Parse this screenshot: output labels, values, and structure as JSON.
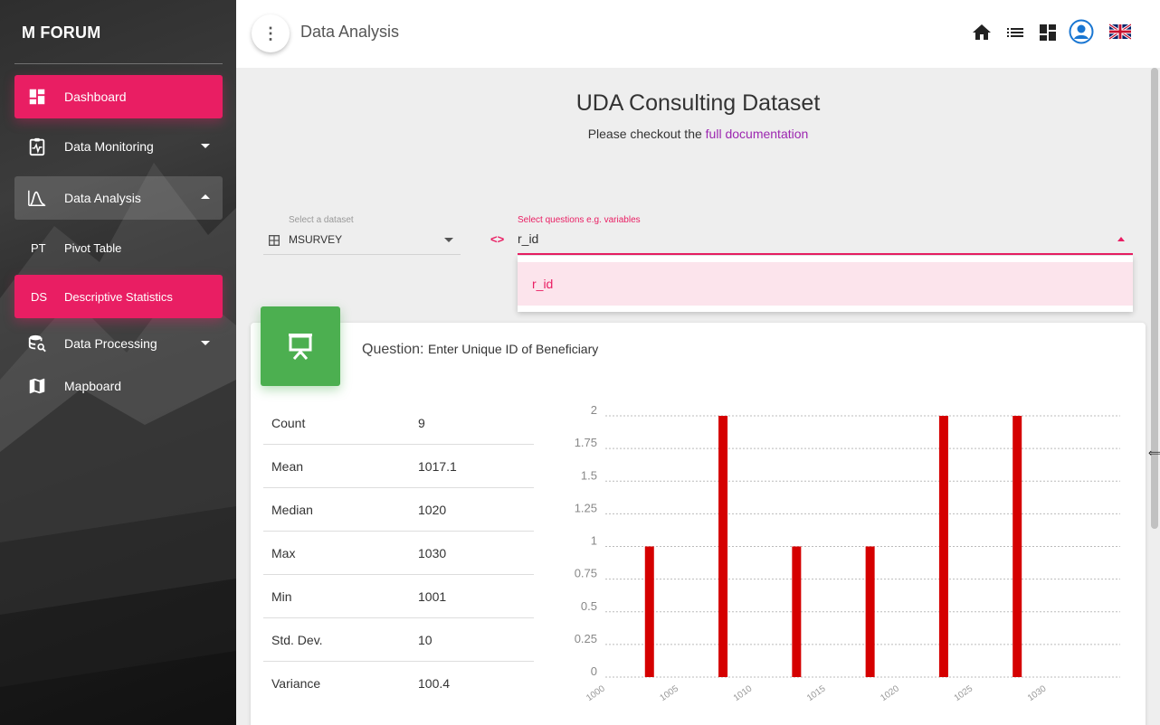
{
  "sidebar": {
    "brand": "M FORUM",
    "items": [
      {
        "label": "Dashboard"
      },
      {
        "label": "Data Monitoring"
      },
      {
        "label": "Data Analysis"
      },
      {
        "abbr": "PT",
        "label": "Pivot Table"
      },
      {
        "abbr": "DS",
        "label": "Descriptive Statistics"
      },
      {
        "label": "Data Processing"
      },
      {
        "label": "Mapboard"
      }
    ]
  },
  "topbar": {
    "menu_icon": "⋮",
    "title": "Data Analysis",
    "icons": [
      "home-icon",
      "list-icon",
      "dashboard-icon",
      "account-icon",
      "uk-flag-icon"
    ]
  },
  "main": {
    "title": "UDA Consulting Dataset",
    "subtitle_prefix": "Please checkout the ",
    "subtitle_link": "full documentation"
  },
  "dataset_select": {
    "label": "Select a dataset",
    "value": "MSURVEY"
  },
  "question_select": {
    "label": "Select questions e.g. variables",
    "value": "r_id",
    "options": [
      "r_id"
    ]
  },
  "card": {
    "question_prefix": "Question: ",
    "question_text": "Enter Unique ID of Beneficiary",
    "stats": [
      {
        "name": "Count",
        "value": "9"
      },
      {
        "name": "Mean",
        "value": "1017.1"
      },
      {
        "name": "Median",
        "value": "1020"
      },
      {
        "name": "Max",
        "value": "1030"
      },
      {
        "name": "Min",
        "value": "1001"
      },
      {
        "name": "Std. Dev.",
        "value": "10"
      },
      {
        "name": "Variance",
        "value": "100.4"
      }
    ]
  },
  "colors": {
    "accent": "#e91e63",
    "card_icon": "#4caf50",
    "bar": "#d50000",
    "link": "#9c27b0"
  },
  "chart_data": {
    "type": "bar",
    "x": [
      1003,
      1008,
      1013,
      1018,
      1023,
      1028
    ],
    "values": [
      1,
      2,
      1,
      1,
      2,
      2
    ],
    "xticks": [
      "1000",
      "1005",
      "1010",
      "1015",
      "1020",
      "1025",
      "1030"
    ],
    "yticks": [
      "0",
      "0.25",
      "0.5",
      "0.75",
      "1",
      "1.25",
      "1.5",
      "1.75",
      "2"
    ],
    "xlim": [
      1000,
      1035
    ],
    "ylim": [
      0,
      2
    ],
    "grid": true
  }
}
